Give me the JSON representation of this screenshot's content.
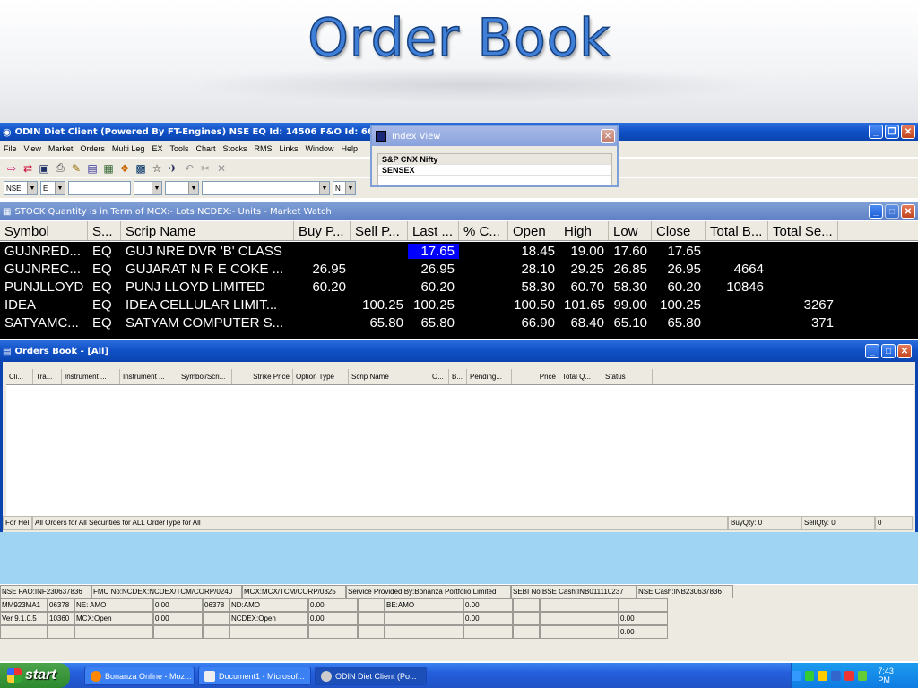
{
  "slide": {
    "title": "Order Book"
  },
  "app": {
    "title": "ODIN Diet Client  (Powered By FT-Engines)  NSE EQ Id: 14506  F&O Id: 669",
    "menu": [
      "File",
      "View",
      "Market",
      "Orders",
      "Multi Leg",
      "EX",
      "Tools",
      "Chart",
      "Stocks",
      "RMS",
      "Links",
      "Window",
      "Help"
    ],
    "filters": {
      "exchange": "NSE",
      "segment": "E",
      "instrument": "N"
    }
  },
  "index_view": {
    "title": "Index View",
    "rows": [
      "S&P CNX Nifty",
      "SENSEX"
    ]
  },
  "market_watch": {
    "title": "STOCK    Quantity is in Term of  MCX:- Lots  NCDEX:- Units - Market Watch",
    "columns": [
      "Symbol",
      "S...",
      "Scrip Name",
      "Buy P...",
      "Sell P...",
      "Last ...",
      "% C...",
      "Open",
      "High",
      "Low",
      "Close",
      "Total B...",
      "Total Se..."
    ],
    "rows": [
      [
        "GUJNRED...",
        "EQ",
        "GUJ NRE DVR 'B' CLASS",
        "",
        "",
        "17.65",
        "",
        "18.45",
        "19.00",
        "17.60",
        "17.65",
        "",
        ""
      ],
      [
        "GUJNREC...",
        "EQ",
        "GUJARAT N R E COKE ...",
        "26.95",
        "",
        "26.95",
        "",
        "28.10",
        "29.25",
        "26.85",
        "26.95",
        "4664",
        ""
      ],
      [
        "PUNJLLOYD",
        "EQ",
        "PUNJ LLOYD LIMITED",
        "60.20",
        "",
        "60.20",
        "",
        "58.30",
        "60.70",
        "58.30",
        "60.20",
        "10846",
        ""
      ],
      [
        "IDEA",
        "EQ",
        "IDEA CELLULAR LIMIT...",
        "",
        "100.25",
        "100.25",
        "",
        "100.50",
        "101.65",
        "99.00",
        "100.25",
        "",
        "3267"
      ],
      [
        "SATYAMC...",
        "EQ",
        "SATYAM COMPUTER S...",
        "",
        "65.80",
        "65.80",
        "",
        "66.90",
        "68.40",
        "65.10",
        "65.80",
        "",
        "371"
      ]
    ]
  },
  "orders_book": {
    "title": "Orders Book - [All]",
    "columns": [
      "Cli...",
      "Tra...",
      "Instrument ...",
      "Instrument ...",
      "Symbol/Scri...",
      "Strike Price",
      "Option Type",
      "Scrip Name",
      "O...",
      "B...",
      "Pending...",
      "Price",
      "Total Q...",
      "Status"
    ],
    "status": {
      "help": "For Hel",
      "filter": "All Orders for All Securities for  ALL OrderType  for All",
      "buy_qty": "BuyQty: 0",
      "sell_qty": "SellQty: 0",
      "count": "0"
    }
  },
  "info_grid": {
    "row1": [
      "NSE FAO:INF230637836",
      "FMC No:NCDEX:NCDEX/TCM/CORP/0240",
      "MCX:MCX/TCM/CORP/0325",
      "Service Provided By:Bonanza Portfolio Limited",
      "SEBI No:BSE Cash:INB011110237",
      "NSE Cash:INB230637836"
    ],
    "row2": [
      "MM923MA1",
      "06378",
      "NE: AMO",
      "0.00",
      "06378",
      "ND:AMO",
      "0.00",
      "",
      "BE:AMO",
      "0.00",
      "",
      "",
      ""
    ],
    "row3": [
      "Ver 9.1.0.5",
      "10360",
      "MCX:Open",
      "0.00",
      "",
      "NCDEX:Open",
      "0.00",
      "",
      "",
      "0.00",
      "",
      "",
      "0.00"
    ],
    "row4": [
      "",
      "",
      "",
      "",
      "",
      "",
      "",
      "",
      "",
      "",
      "",
      "",
      "0.00"
    ]
  },
  "taskbar": {
    "start": "start",
    "tasks": [
      "Bonanza Online - Moz...",
      "Document1 - Microsof...",
      "ODIN Diet Client  (Po..."
    ],
    "clock": "7:43 PM"
  }
}
